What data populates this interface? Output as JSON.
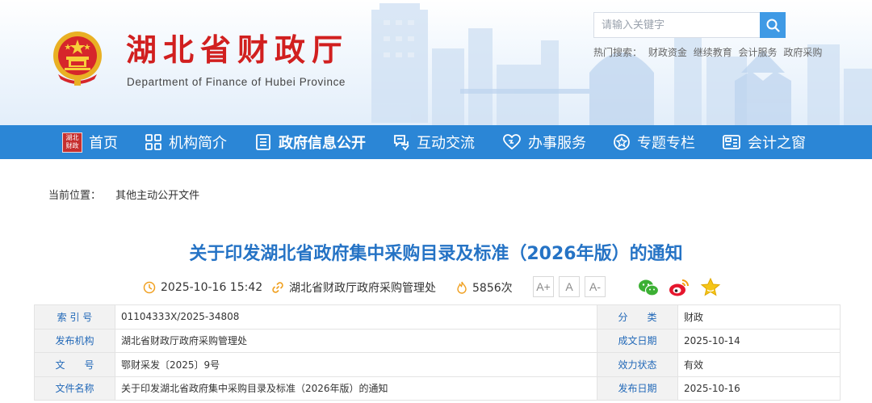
{
  "header": {
    "title": "湖北省财政厅",
    "subtitle": "Department of Finance of Hubei Province",
    "search": {
      "placeholder": "请输入关键字"
    },
    "hot_label": "热门搜索：",
    "hot_links": [
      "财政资金",
      "继续教育",
      "会计服务",
      "政府采购"
    ]
  },
  "home_seal": [
    "湖北",
    "财政"
  ],
  "nav": [
    {
      "label": "首页",
      "icon": "home-seal-icon"
    },
    {
      "label": "机构简介",
      "icon": "grid-icon"
    },
    {
      "label": "政府信息公开",
      "icon": "document-list-icon",
      "active": true
    },
    {
      "label": "互动交流",
      "icon": "interaction-icon"
    },
    {
      "label": "办事服务",
      "icon": "heart-icon"
    },
    {
      "label": "专题专栏",
      "icon": "star-circle-icon"
    },
    {
      "label": "会计之窗",
      "icon": "calculator-icon"
    }
  ],
  "breadcrumb": {
    "label": "当前位置：",
    "item": "其他主动公开文件"
  },
  "article": {
    "title": "关于印发湖北省政府集中采购目录及标准（2026年版）的通知",
    "date": "2025-10-16 15:42",
    "source": "湖北省财政厅政府采购管理处",
    "views": "5856次",
    "font_sizes": [
      "A+",
      "A",
      "A-"
    ]
  },
  "info_table": {
    "rows": [
      {
        "k1": "索 引 号",
        "v1": "01104333X/2025-34808",
        "k2": "分　　类",
        "v2": "财政"
      },
      {
        "k1": "发布机构",
        "v1": "湖北省财政厅政府采购管理处",
        "k2": "成文日期",
        "v2": "2025-10-14"
      },
      {
        "k1": "文　　号",
        "v1": "鄂财采发〔2025〕9号",
        "k2": "效力状态",
        "v2": "有效"
      },
      {
        "k1": "文件名称",
        "v1": "关于印发湖北省政府集中采购目录及标准（2026年版）的通知",
        "k2": "发布日期",
        "v2": "2025-10-16"
      }
    ]
  },
  "colors": {
    "brand_red": "#d11f1f",
    "nav_blue": "#2b86d6",
    "title_blue": "#2573c5",
    "search_blue": "#3f9ae5"
  }
}
